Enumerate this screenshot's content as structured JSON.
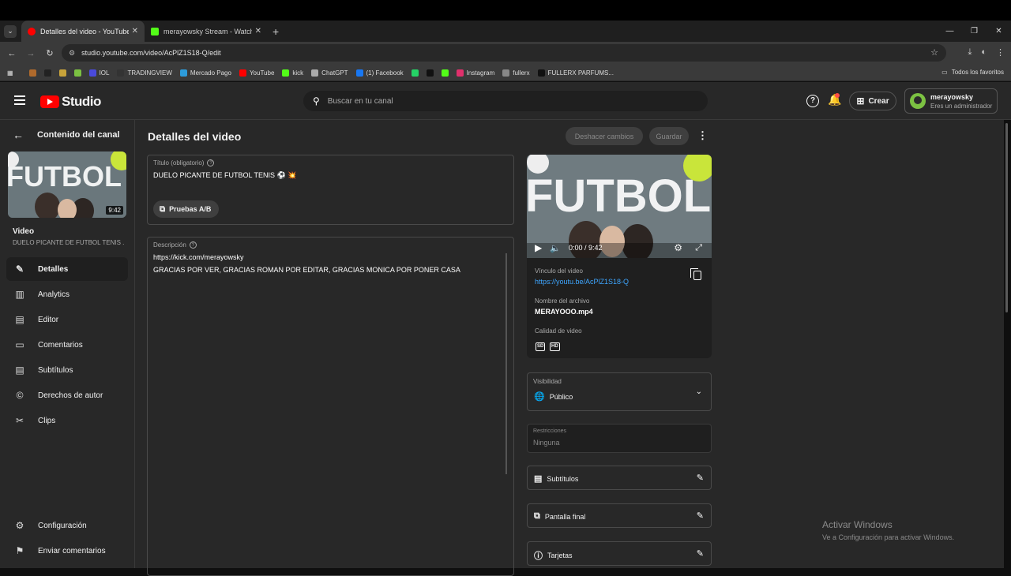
{
  "browser": {
    "tabs": [
      {
        "title": "Detalles del video - YouTube St",
        "color": "#ff0000"
      },
      {
        "title": "merayowsky Stream - Watch Li",
        "color": "#53fc18"
      }
    ],
    "new_tab": "+",
    "url": "studio.youtube.com/video/AcPlZ1S18-Q/edit",
    "bookmarks": [
      {
        "label": "",
        "color": "#b06a2c"
      },
      {
        "label": "",
        "color": "#222222"
      },
      {
        "label": "",
        "color": "#c9a43a"
      },
      {
        "label": "",
        "color": "#7cc242"
      },
      {
        "label": "IOL",
        "color": "#4a4adb"
      },
      {
        "label": "TRADINGVIEW",
        "color": "#333333"
      },
      {
        "label": "Mercado Pago",
        "color": "#2d9cdb"
      },
      {
        "label": "YouTube",
        "color": "#ff0000"
      },
      {
        "label": "kick",
        "color": "#53fc18"
      },
      {
        "label": "ChatGPT",
        "color": "#aaaaaa"
      },
      {
        "label": "(1) Facebook",
        "color": "#1877f2"
      },
      {
        "label": "",
        "color": "#25d366"
      },
      {
        "label": "",
        "color": "#111111"
      },
      {
        "label": "",
        "color": "#53fc18"
      },
      {
        "label": "Instagram",
        "color": "#e1306c"
      },
      {
        "label": "fullerx",
        "color": "#888888"
      },
      {
        "label": "FULLERX PARFUMS...",
        "color": "#111111"
      }
    ],
    "all_bookmarks": "Todos los favoritos"
  },
  "header": {
    "logo_text": "Studio",
    "search_placeholder": "Buscar en tu canal",
    "create_label": "Crear",
    "account_name": "merayowsky",
    "account_role": "Eres un administrador"
  },
  "sidebar": {
    "back_label": "Contenido del canal",
    "thumb_duration": "9:42",
    "video_label": "Video",
    "video_title": "DUELO PICANTE DE FUTBOL TENIS ...",
    "nav": [
      {
        "label": "Detalles",
        "icon": "pencil-icon",
        "glyph": "✎"
      },
      {
        "label": "Analytics",
        "icon": "analytics-icon",
        "glyph": "▥"
      },
      {
        "label": "Editor",
        "icon": "editor-icon",
        "glyph": "🎬"
      },
      {
        "label": "Comentarios",
        "icon": "comments-icon",
        "glyph": "▤"
      },
      {
        "label": "Subtítulos",
        "icon": "subtitles-icon",
        "glyph": "▭"
      },
      {
        "label": "Derechos de autor",
        "icon": "copyright-icon",
        "glyph": "©"
      },
      {
        "label": "Clips",
        "icon": "scissors-icon",
        "glyph": "✂"
      }
    ],
    "settings_label": "Configuración",
    "feedback_label": "Enviar comentarios"
  },
  "main": {
    "page_title": "Detalles del video",
    "undo_label": "Deshacer cambios",
    "save_label": "Guardar",
    "title_field_label": "Título (obligatorio)",
    "title_value": "DUELO PICANTE DE FUTBOL TENIS ⚽ 💥",
    "ab_test_label": "Pruebas A/B",
    "description_label": "Descripción",
    "description_lines": [
      "https://kick.com/merayowsky",
      "GRACIAS POR VER, GRACIAS ROMAN POR EDITAR, GRACIAS MONICA POR PONER CASA"
    ]
  },
  "video_panel": {
    "time": "0:00 / 9:42",
    "link_label": "Vínculo del video",
    "link_value": "https://youtu.be/AcPlZ1S18-Q",
    "filename_label": "Nombre del archivo",
    "filename_value": "MERAYOOO.mp4",
    "quality_label": "Calidad de video",
    "quality_badges": [
      "SD",
      "HD"
    ]
  },
  "visibility": {
    "label": "Visibilidad",
    "value": "Público"
  },
  "restrictions": {
    "label": "Restricciones",
    "value": "Ninguna"
  },
  "extras": [
    {
      "label": "Subtítulos"
    },
    {
      "label": "Pantalla final"
    },
    {
      "label": "Tarjetas"
    }
  ],
  "watermark": {
    "line1": "Activar Windows",
    "line2": "Ve a Configuración para activar Windows."
  }
}
